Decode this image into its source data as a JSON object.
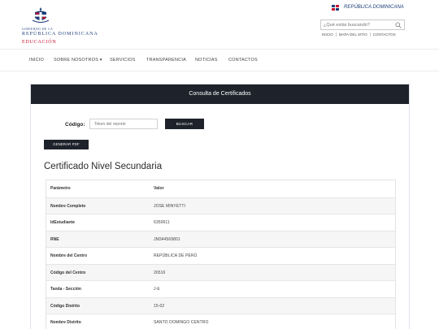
{
  "header": {
    "logo": {
      "small_line": "GOBIERNO DE LA",
      "name": "REPÚBLICA DOMINICANA",
      "ministry": "EDUCACIÓN"
    },
    "republic_link": "REPÚBLICA DOMINICANA",
    "search": {
      "placeholder": "¿Qué estás buscando?"
    },
    "quick_links": [
      "INICIO",
      "MAPA DEL SITIO",
      "CONTACTOS"
    ]
  },
  "nav": {
    "items": [
      "INICIO",
      "SOBRE NOSOTROS ▾",
      "SERVICIOS",
      "TRANSPARENCIA",
      "NOTICIAS",
      "CONTACTOS"
    ]
  },
  "card": {
    "header_title": "Consulta de Certificados",
    "code_label": "Código:",
    "code_placeholder": "Token del reporte",
    "search_button": "BUSCAR",
    "pdf_button": "GENERAR PDF",
    "certificate_title": "Certificado Nivel Secundaria",
    "table": {
      "headers": [
        "Parámetro",
        "Valor"
      ],
      "rows": [
        [
          "Nombre Completo",
          "JOSE MINYETTI"
        ],
        [
          "IdEstudiante",
          "6350611"
        ],
        [
          "RNE",
          "JM344569801"
        ],
        [
          "Nombre del Centro",
          "REPÚBLICA DE PERÚ"
        ],
        [
          "Código del Centro",
          "26516"
        ],
        [
          "Tanda - Sección",
          "J-E"
        ],
        [
          "Código Distrito",
          "15-02"
        ],
        [
          "Nombre Distrito",
          "SANTO DOMINGO CENTRO"
        ]
      ]
    }
  },
  "colors": {
    "navy": "#1c3e7a",
    "red": "#c8102e",
    "dark_header": "#1e232b"
  },
  "icons": {
    "coat_of_arms": "coat-of-arms-icon",
    "flag": "flag-icon",
    "search": "search-icon"
  }
}
